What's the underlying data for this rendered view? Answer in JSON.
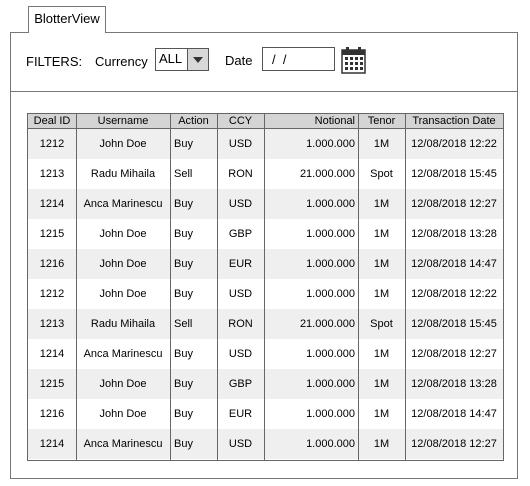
{
  "tab": {
    "label": "BlotterView"
  },
  "filters": {
    "title": "FILTERS:",
    "currency_label": "Currency",
    "currency_value": "ALL",
    "date_label": "Date",
    "date_placeholder": "/  /"
  },
  "table": {
    "columns": [
      "Deal ID",
      "Username",
      "Action",
      "CCY",
      "Notional",
      "Tenor",
      "Transaction Date"
    ],
    "rows": [
      [
        "1212",
        "John Doe",
        "Buy",
        "USD",
        "1.000.000",
        "1M",
        "12/08/2018 12:22"
      ],
      [
        "1213",
        "Radu Mihaila",
        "Sell",
        "RON",
        "21.000.000",
        "Spot",
        "12/08/2018 15:45"
      ],
      [
        "1214",
        "Anca Marinescu",
        "Buy",
        "USD",
        "1.000.000",
        "1M",
        "12/08/2018 12:27"
      ],
      [
        "1215",
        "John Doe",
        "Buy",
        "GBP",
        "1.000.000",
        "1M",
        "12/08/2018 13:28"
      ],
      [
        "1216",
        "John Doe",
        "Buy",
        "EUR",
        "1.000.000",
        "1M",
        "12/08/2018 14:47"
      ],
      [
        "1212",
        "John Doe",
        "Buy",
        "USD",
        "1.000.000",
        "1M",
        "12/08/2018 12:22"
      ],
      [
        "1213",
        "Radu Mihaila",
        "Sell",
        "RON",
        "21.000.000",
        "Spot",
        "12/08/2018 15:45"
      ],
      [
        "1214",
        "Anca Marinescu",
        "Buy",
        "USD",
        "1.000.000",
        "1M",
        "12/08/2018 12:27"
      ],
      [
        "1215",
        "John Doe",
        "Buy",
        "GBP",
        "1.000.000",
        "1M",
        "12/08/2018 13:28"
      ],
      [
        "1216",
        "John Doe",
        "Buy",
        "EUR",
        "1.000.000",
        "1M",
        "12/08/2018 14:47"
      ],
      [
        "1214",
        "Anca Marinescu",
        "Buy",
        "USD",
        "1.000.000",
        "1M",
        "12/08/2018 12:27"
      ]
    ]
  },
  "colors": {
    "header_bg": "#d4d4d4",
    "alt_row_bg": "#efefef",
    "border": "#666666"
  },
  "icons": {
    "calendar": "calendar-icon",
    "dropdown": "chevron-down-icon"
  }
}
